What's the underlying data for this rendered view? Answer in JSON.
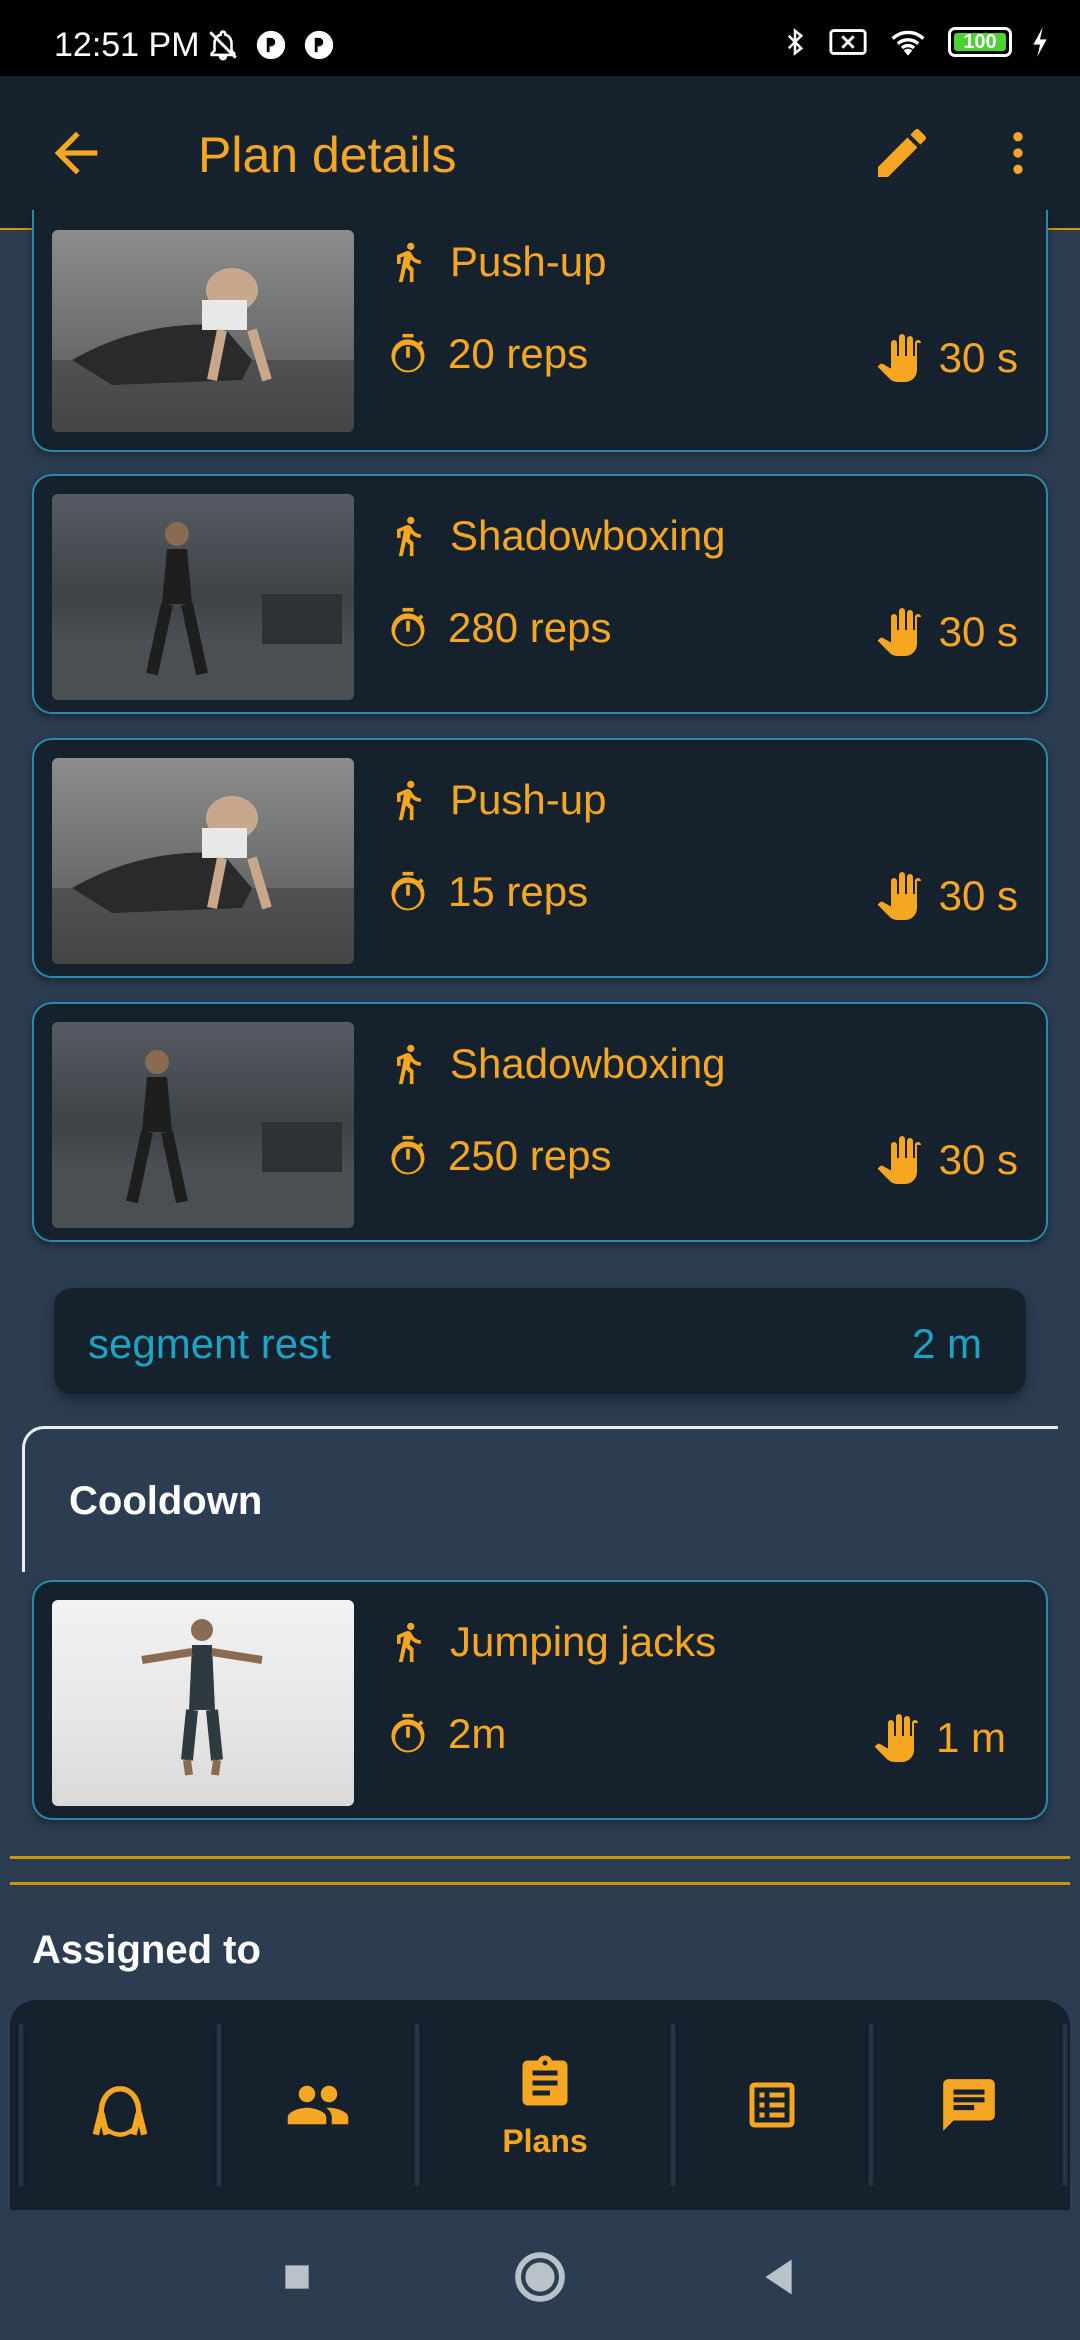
{
  "status_bar": {
    "time": "12:51 PM",
    "battery": "100"
  },
  "app_bar": {
    "title": "Plan details"
  },
  "exercises": [
    {
      "name": "Push-up",
      "reps": "20 reps",
      "rest": "30 s"
    },
    {
      "name": "Shadowboxing",
      "reps": "280 reps",
      "rest": "30 s"
    },
    {
      "name": "Push-up",
      "reps": "15 reps",
      "rest": "30 s"
    },
    {
      "name": "Shadowboxing",
      "reps": "250 reps",
      "rest": "30 s"
    }
  ],
  "segment_rest": {
    "label": "segment rest",
    "value": "2 m"
  },
  "cooldown": {
    "title": "Cooldown",
    "exercise": {
      "name": "Jumping jacks",
      "reps": "2m",
      "rest": "1 m"
    }
  },
  "assigned": {
    "title": "Assigned to"
  },
  "bottom_nav": {
    "items": [
      {
        "icon": "jump-rope-icon",
        "label": ""
      },
      {
        "icon": "people-icon",
        "label": ""
      },
      {
        "icon": "clipboard-icon",
        "label": "Plans"
      },
      {
        "icon": "list-icon",
        "label": ""
      },
      {
        "icon": "chat-icon",
        "label": ""
      }
    ]
  },
  "colors": {
    "accent": "#f5a623",
    "teal": "#1fa3c5",
    "card_bg": "#16212e",
    "page_bg": "#2c3d51"
  }
}
